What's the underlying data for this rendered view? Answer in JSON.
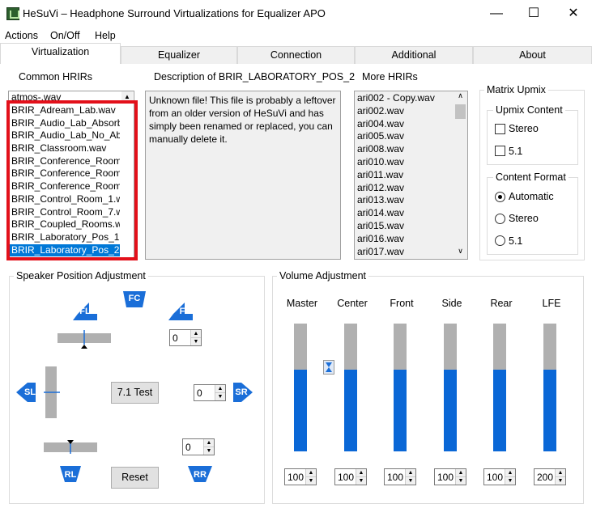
{
  "window": {
    "title": "HeSuVi – Headphone Surround Virtualizations for Equalizer APO",
    "minimize": "—",
    "maximize": "☐",
    "close": "✕"
  },
  "menu": [
    "Actions",
    "On/Off",
    "Help"
  ],
  "tabs": [
    "Virtualization",
    "Equalizer",
    "Connection",
    "Additional",
    "About"
  ],
  "common_hrirs": {
    "label": "Common HRIRs",
    "header_item": "atmos-.wav",
    "items": [
      "BRIR_Adream_Lab.wav",
      "BRIR_Audio_Lab_Absorb",
      "BRIR_Audio_Lab_No_Ab",
      "BRIR_Classroom.wav",
      "BRIR_Conference_Room",
      "BRIR_Conference_Room",
      "BRIR_Conference_Room",
      "BRIR_Control_Room_1.w",
      "BRIR_Control_Room_7.w",
      "BRIR_Coupled_Rooms.w",
      "BRIR_Laboratory_Pos_1.",
      "BRIR_Laboratory_Pos_2."
    ],
    "selected_index": 11
  },
  "description": {
    "label": "Description of BRIR_LABORATORY_POS_2",
    "text": "Unknown file! This file is probably a leftover from an older version of HeSuVi and has simply been renamed or replaced, you can manually delete it."
  },
  "more_hrirs": {
    "label": "More HRIRs",
    "items": [
      "ari002 - Copy.wav",
      "ari002.wav",
      "ari004.wav",
      "ari005.wav",
      "ari008.wav",
      "ari010.wav",
      "ari011.wav",
      "ari012.wav",
      "ari013.wav",
      "ari014.wav",
      "ari015.wav",
      "ari016.wav",
      "ari017.wav"
    ]
  },
  "matrix_upmix": {
    "label": "Matrix Upmix",
    "upmix_content": {
      "label": "Upmix Content",
      "options": [
        "Stereo",
        "5.1"
      ]
    },
    "content_format": {
      "label": "Content Format",
      "options": [
        "Automatic",
        "Stereo",
        "5.1"
      ],
      "selected": "Automatic"
    }
  },
  "speaker": {
    "label": "Speaker Position Adjustment",
    "FL": "FL",
    "FC": "FC",
    "FR": "FR",
    "SL": "SL",
    "SR": "SR",
    "RL": "RL",
    "RR": "RR",
    "front_value": "0",
    "side_value": "0",
    "rear_value": "0",
    "test_button": "7.1 Test",
    "reset_button": "Reset"
  },
  "volume": {
    "label": "Volume Adjustment",
    "channels": [
      {
        "name": "Master",
        "value": "100",
        "level": 0.64
      },
      {
        "name": "Center",
        "value": "100",
        "level": 0.64
      },
      {
        "name": "Front",
        "value": "100",
        "level": 0.64
      },
      {
        "name": "Side",
        "value": "100",
        "level": 0.64
      },
      {
        "name": "Rear",
        "value": "100",
        "level": 0.64
      },
      {
        "name": "LFE",
        "value": "200",
        "level": 0.64
      }
    ]
  },
  "colors": {
    "accent": "#0078d7",
    "highlight_box": "#e3101a",
    "speaker": "#1a6ed8"
  }
}
